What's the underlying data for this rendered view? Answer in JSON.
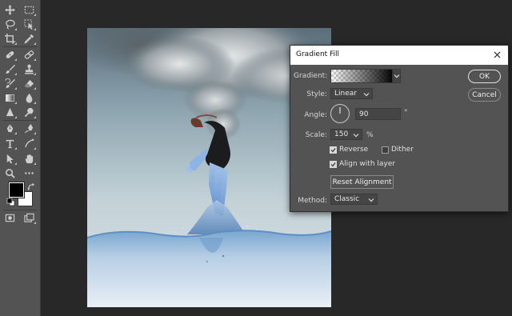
{
  "toolbar": {
    "tools": [
      {
        "name": "move-tool",
        "icon": "move-icon"
      },
      {
        "name": "marquee-tool",
        "icon": "rect-marquee-icon"
      },
      {
        "name": "lasso-tool",
        "icon": "lasso-icon"
      },
      {
        "name": "object-select-tool",
        "icon": "object-select-icon"
      },
      {
        "name": "crop-tool",
        "icon": "crop-icon"
      },
      {
        "name": "eyedropper-tool",
        "icon": "eyedropper-icon"
      },
      {
        "name": "healing-brush-tool",
        "icon": "bandage-icon"
      },
      {
        "name": "patch-tool",
        "icon": "patch-icon"
      },
      {
        "name": "brush-tool",
        "icon": "brush-icon"
      },
      {
        "name": "clone-stamp-tool",
        "icon": "stamp-icon"
      },
      {
        "name": "history-brush-tool",
        "icon": "history-brush-icon"
      },
      {
        "name": "eraser-tool",
        "icon": "eraser-icon"
      },
      {
        "name": "gradient-tool",
        "icon": "gradient-icon"
      },
      {
        "name": "blur-tool",
        "icon": "drop-icon"
      },
      {
        "name": "pen-tool",
        "icon": "pen-icon"
      },
      {
        "name": "type-tool",
        "icon": "type-icon"
      },
      {
        "name": "path-select-tool",
        "icon": "arrow-icon"
      },
      {
        "name": "hand-tool",
        "icon": "hand-icon"
      },
      {
        "name": "zoom-tool",
        "icon": "zoom-icon"
      },
      {
        "name": "more-tools",
        "icon": "more-icon"
      }
    ],
    "colors": {
      "foreground": "#000000",
      "background": "#ffffff"
    }
  },
  "dialog": {
    "title": "Gradient Fill",
    "gradient_label": "Gradient:",
    "style_label": "Style:",
    "style_value": "Linear",
    "angle_label": "Angle:",
    "angle_value": "90",
    "angle_unit": "°",
    "scale_label": "Scale:",
    "scale_value": "150",
    "scale_unit": "%",
    "reverse_label": "Reverse",
    "reverse_checked": true,
    "dither_label": "Dither",
    "dither_checked": false,
    "align_label": "Align with layer",
    "align_checked": true,
    "reset_label": "Reset Alignment",
    "method_label": "Method:",
    "method_value": "Classic",
    "ok_label": "OK",
    "cancel_label": "Cancel"
  },
  "colors": {
    "app_background": "#282828",
    "panel": "#535353",
    "field": "#454545",
    "checkbox_on": "#d8d8d8"
  }
}
